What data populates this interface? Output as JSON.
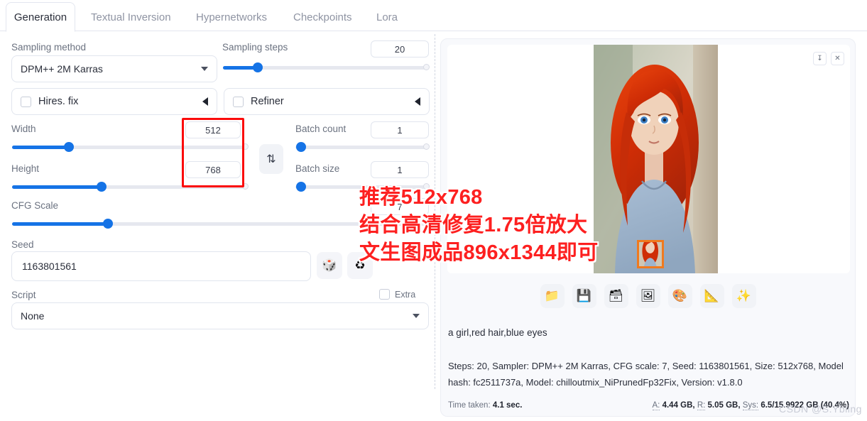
{
  "tabs": [
    {
      "label": "Generation",
      "active": true
    },
    {
      "label": "Textual Inversion",
      "active": false
    },
    {
      "label": "Hypernetworks",
      "active": false
    },
    {
      "label": "Checkpoints",
      "active": false
    },
    {
      "label": "Lora",
      "active": false
    }
  ],
  "left_panel": {
    "sampling_method": {
      "label": "Sampling method",
      "value": "DPM++ 2M Karras"
    },
    "sampling_steps": {
      "label": "Sampling steps",
      "value": "20",
      "percent": 17
    },
    "hires_fix": {
      "label": "Hires. fix",
      "checked": false
    },
    "refiner": {
      "label": "Refiner",
      "checked": false
    },
    "width": {
      "label": "Width",
      "value": "512",
      "percent": 24
    },
    "height": {
      "label": "Height",
      "value": "768",
      "percent": 38
    },
    "swap_icon": "swap-vertical-icon",
    "batch_count": {
      "label": "Batch count",
      "value": "1",
      "percent": 0
    },
    "batch_size": {
      "label": "Batch size",
      "value": "1",
      "percent": 0
    },
    "cfg_scale": {
      "label": "CFG Scale",
      "value": "7",
      "percent": 24
    },
    "seed": {
      "label": "Seed",
      "value": "1163801561"
    },
    "seed_random_icon": "dice-icon",
    "seed_reuse_icon": "recycle-icon",
    "extra": {
      "label": "Extra",
      "checked": false
    },
    "script": {
      "label": "Script",
      "value": "None"
    }
  },
  "right_panel": {
    "download_icon": "download-icon",
    "close_icon": "close-icon",
    "toolbar_buttons": [
      {
        "name": "open-folder-button",
        "icon": "folder-icon",
        "glyph": "📁"
      },
      {
        "name": "save-button",
        "icon": "floppy-disk-icon",
        "glyph": "💾"
      },
      {
        "name": "save-zip-button",
        "icon": "card-file-box-icon",
        "glyph": "🗃"
      },
      {
        "name": "send-to-img2img-button",
        "icon": "framed-picture-icon",
        "glyph": "🖼"
      },
      {
        "name": "send-to-inpaint-button",
        "icon": "artist-palette-icon",
        "glyph": "🎨"
      },
      {
        "name": "send-to-extras-button",
        "icon": "triangular-ruler-icon",
        "glyph": "📐"
      },
      {
        "name": "enhance-button",
        "icon": "sparkles-icon",
        "glyph": "✨"
      }
    ],
    "prompt_output": "a girl,red hair,blue eyes",
    "generation_info": "Steps: 20, Sampler: DPM++ 2M Karras, CFG scale: 7, Seed: 1163801561, Size: 512x768, Model hash: fc2511737a, Model: chilloutmix_NiPrunedFp32Fix, Version: v1.8.0",
    "time_taken_label": "Time taken:",
    "time_taken_value": "4.1 sec.",
    "mem_a_label": "A:",
    "mem_a_value": "4.44 GB,",
    "mem_r_label": "R:",
    "mem_r_value": "5.05 GB,",
    "mem_sys_label": "Sys:",
    "mem_sys_value": "6.5/15.9922 GB (40.4%)"
  },
  "annotations": {
    "line1": "推荐512x768",
    "line2": "结合高清修复1.75倍放大",
    "line3": "文生图成品896x1344即可",
    "box_color": "#fb0b0b",
    "thumb_border_color": "#f07a1e"
  },
  "watermark": "CSDN @S.Ybling",
  "colors": {
    "accent": "#1573e6",
    "annotation_red": "#fd2020",
    "panel_bg": "#f8f9fc"
  }
}
